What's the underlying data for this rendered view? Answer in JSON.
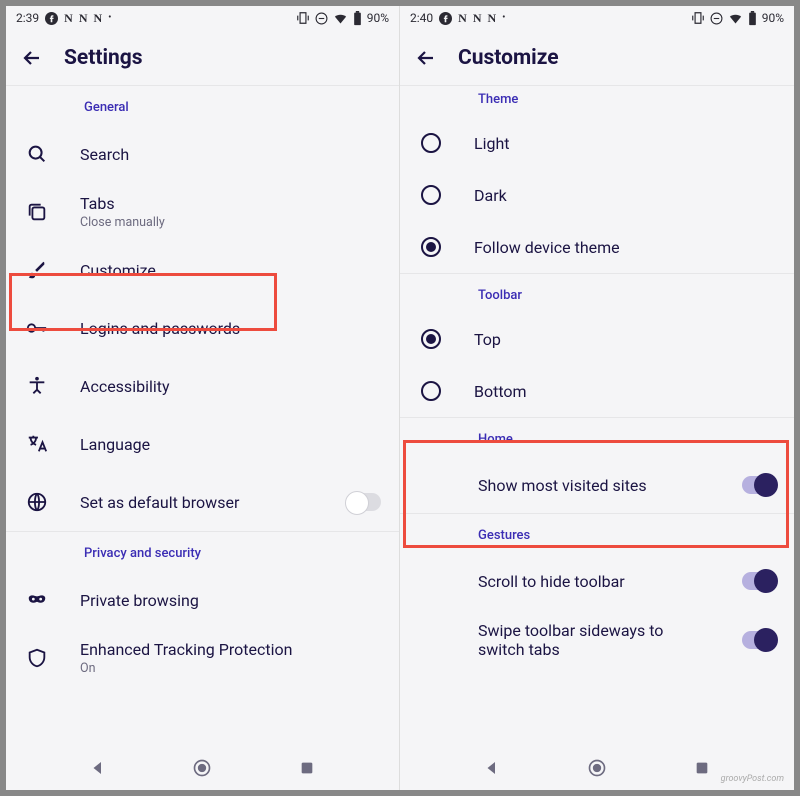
{
  "left": {
    "status": {
      "time": "2:39",
      "battery_pct": "90%"
    },
    "appbar": {
      "title": "Settings"
    },
    "sections": {
      "general_header": "General",
      "search": "Search",
      "tabs": {
        "label": "Tabs",
        "sub": "Close manually"
      },
      "customize": "Customize",
      "logins": "Logins and passwords",
      "accessibility": "Accessibility",
      "language": "Language",
      "default_browser": "Set as default browser",
      "privacy_header": "Privacy and security",
      "private_browsing": "Private browsing",
      "tracking": {
        "label": "Enhanced Tracking Protection",
        "sub": "On"
      }
    }
  },
  "right": {
    "status": {
      "time": "2:40",
      "battery_pct": "90%"
    },
    "appbar": {
      "title": "Customize"
    },
    "sections": {
      "theme_header": "Theme",
      "theme_light": "Light",
      "theme_dark": "Dark",
      "theme_follow": "Follow device theme",
      "toolbar_header": "Toolbar",
      "toolbar_top": "Top",
      "toolbar_bottom": "Bottom",
      "home_header": "Home",
      "show_most_visited": "Show most visited sites",
      "gestures_header": "Gestures",
      "scroll_hide": "Scroll to hide toolbar",
      "swipe_switch": "Swipe toolbar sideways to switch tabs"
    }
  },
  "watermark": "groovyPost.com"
}
